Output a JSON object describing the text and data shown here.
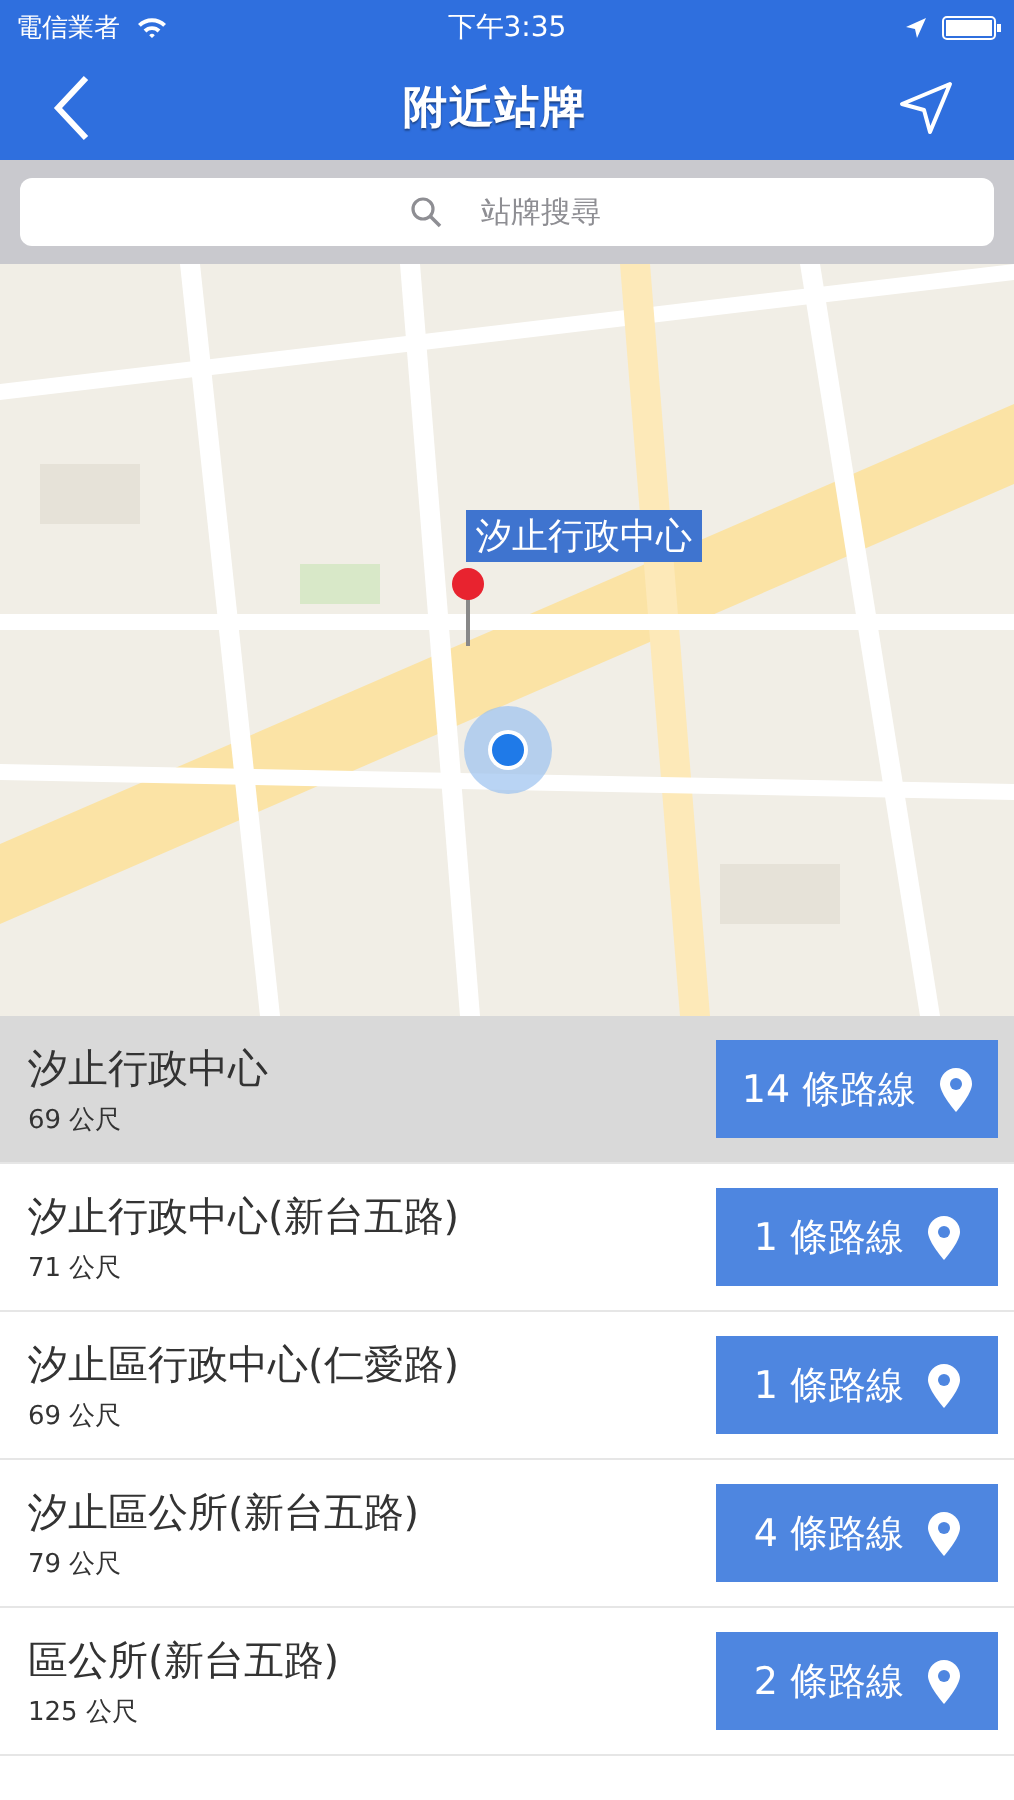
{
  "status_bar": {
    "carrier": "電信業者",
    "time": "下午3:35"
  },
  "nav": {
    "title": "附近站牌"
  },
  "search": {
    "placeholder": "站牌搜尋"
  },
  "map": {
    "callout": "汐止行政中心"
  },
  "stops": [
    {
      "name": "汐止行政中心",
      "distance": "69 公尺",
      "routes": "14 條路線",
      "selected": true
    },
    {
      "name": "汐止行政中心(新台五路)",
      "distance": "71 公尺",
      "routes": "1 條路線",
      "selected": false
    },
    {
      "name": "汐止區行政中心(仁愛路)",
      "distance": "69 公尺",
      "routes": "1 條路線",
      "selected": false
    },
    {
      "name": "汐止區公所(新台五路)",
      "distance": "79 公尺",
      "routes": "4 條路線",
      "selected": false
    },
    {
      "name": "區公所(新台五路)",
      "distance": "125 公尺",
      "routes": "2 條路線",
      "selected": false
    }
  ]
}
